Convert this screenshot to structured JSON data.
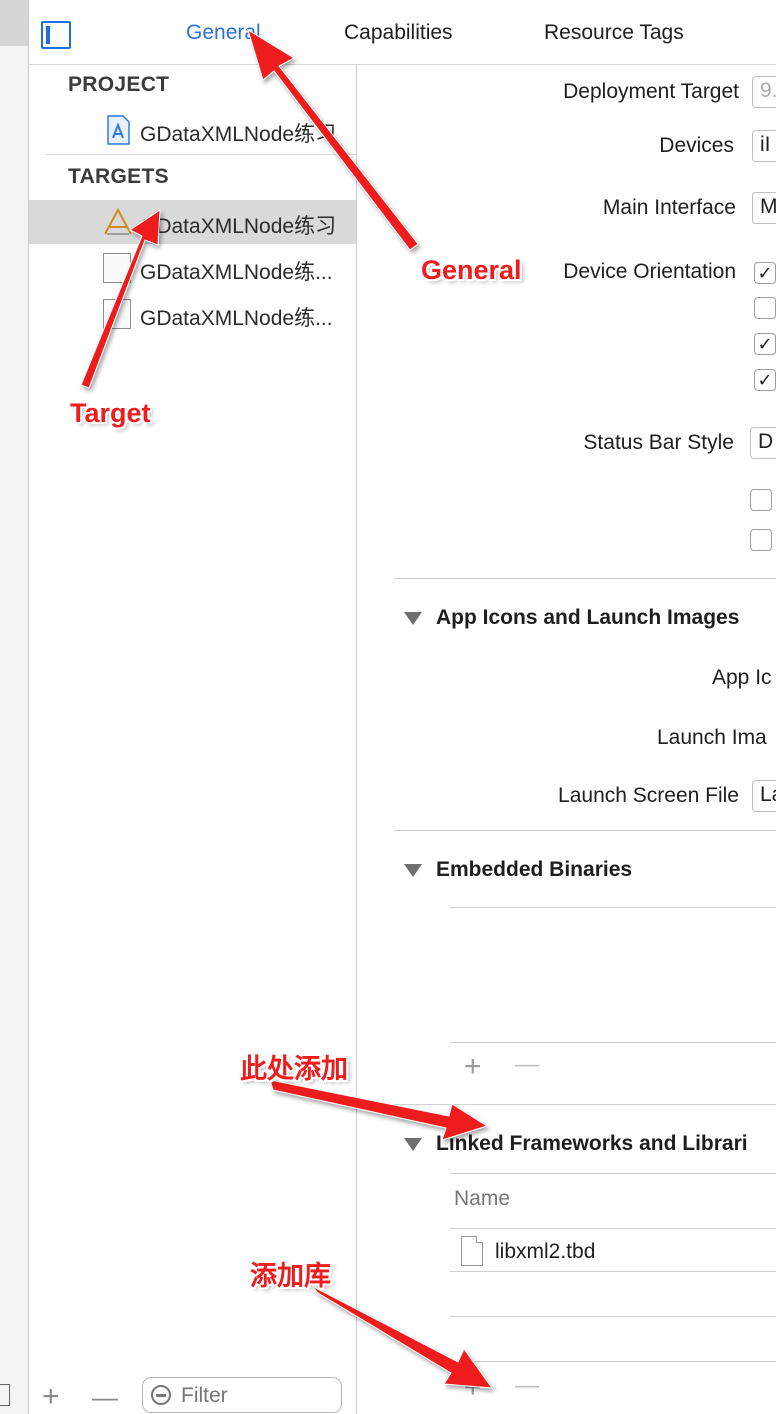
{
  "tabs": [
    {
      "label": "General",
      "active": true
    },
    {
      "label": "Capabilities",
      "active": false
    },
    {
      "label": "Resource Tags",
      "active": false
    }
  ],
  "sidebar": {
    "project_header": "PROJECT",
    "project_item": "GDataXMLNode练习",
    "targets_header": "TARGETS",
    "targets": [
      {
        "label": "GDataXMLNode练习",
        "selected": true
      },
      {
        "label": "GDataXMLNode练...",
        "selected": false
      },
      {
        "label": "GDataXMLNode练...",
        "selected": false
      }
    ],
    "add_symbol": "+",
    "remove_symbol": "—",
    "filter_placeholder": "Filter"
  },
  "deployment": {
    "deployment_target_label": "Deployment Target",
    "deployment_target_value": "9.",
    "devices_label": "Devices",
    "devices_value": "iI",
    "main_interface_label": "Main Interface",
    "main_interface_value": "M",
    "device_orientation_label": "Device Orientation",
    "orientation_checks": [
      true,
      false,
      true,
      true
    ],
    "status_bar_style_label": "Status Bar Style",
    "status_bar_style_value": "D",
    "extra_checks": [
      false,
      false
    ]
  },
  "app_icons": {
    "title": "App Icons and Launch Images",
    "app_icon_label": "App Ic",
    "launch_images_label": "Launch Ima",
    "launch_screen_label": "Launch Screen File",
    "launch_screen_value": "La"
  },
  "embedded": {
    "title": "Embedded Binaries",
    "add_symbol": "+",
    "remove_symbol": "—"
  },
  "linked": {
    "title": "Linked Frameworks and Librari",
    "column_name": "Name",
    "items": [
      "libxml2.tbd"
    ],
    "add_symbol": "+",
    "remove_symbol": "—"
  },
  "annotations": {
    "general": "General",
    "target": "Target",
    "add_here": "此处添加",
    "add_library": "添加库",
    "color": "#ee1c1c"
  },
  "colors": {
    "accent": "#2c72d7",
    "selection": "#d9d9d9"
  }
}
